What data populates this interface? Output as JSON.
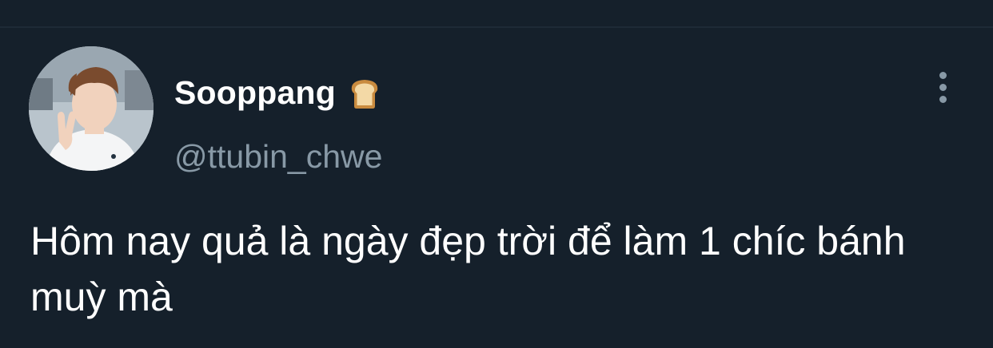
{
  "tweet": {
    "author": {
      "display_name": "Sooppang",
      "handle": "@ttubin_chwe",
      "name_emoji": "bread-icon",
      "avatar": "avatar"
    },
    "text": "Hôm nay quả là ngày đẹp trời để làm 1 chíc bánh muỳ mà",
    "more_icon": "more-vertical-icon"
  },
  "colors": {
    "background": "#15202b",
    "name": "#ffffff",
    "handle": "#8899a6",
    "text": "#ffffff"
  }
}
